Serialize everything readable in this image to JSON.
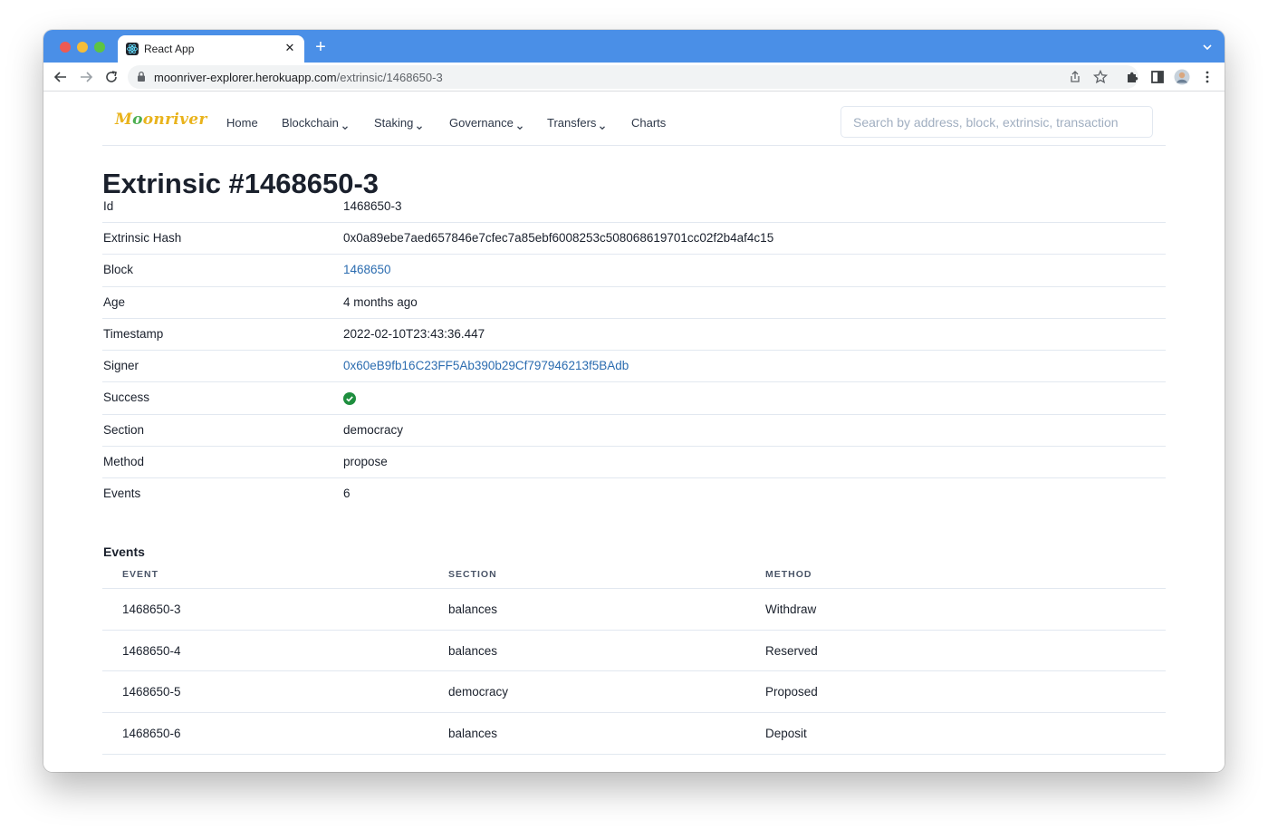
{
  "browser": {
    "tab_title": "React App",
    "url_host": "moonriver-explorer.herokuapp.com",
    "url_path": "/extrinsic/1468650-3"
  },
  "site": {
    "logo_text_1": "M",
    "logo_text_2": "o",
    "logo_text_3": "onriver",
    "nav": [
      {
        "label": "Home",
        "icon": "none"
      },
      {
        "label": "Blockchain",
        "icon": "chevron-down-icon"
      },
      {
        "label": "Staking",
        "icon": "chevron-down-icon"
      },
      {
        "label": "Governance",
        "icon": "chevron-down-icon"
      },
      {
        "label": "Transfers",
        "icon": "chevron-down-icon"
      },
      {
        "label": "Charts",
        "icon": "none"
      }
    ],
    "search_placeholder": "Search by address, block, extrinsic, transaction"
  },
  "page_title": "Extrinsic #1468650-3",
  "details": [
    {
      "key": "Id",
      "value": "1468650-3"
    },
    {
      "key": "Extrinsic Hash",
      "value": "0x0a89ebe7aed657846e7cfec7a85ebf6008253c508068619701cc02f2b4af4c15"
    },
    {
      "key": "Block",
      "value": "1468650"
    },
    {
      "key": "Age",
      "value": "4 months ago"
    },
    {
      "key": "Timestamp",
      "value": "2022-02-10T23:43:36.447"
    },
    {
      "key": "Signer",
      "value": "0x60eB9fb16C23FF5Ab390b29Cf797946213f5BAdb"
    },
    {
      "key": "Success",
      "value": "success-check-icon"
    },
    {
      "key": "Section",
      "value": "democracy"
    },
    {
      "key": "Method",
      "value": "propose"
    },
    {
      "key": "Events",
      "value": "6"
    }
  ],
  "events": {
    "heading": "Events",
    "columns": [
      "EVENT",
      "SECTION",
      "METHOD"
    ],
    "rows": [
      {
        "event": "1468650-3",
        "section": "balances",
        "method": "Withdraw"
      },
      {
        "event": "1468650-4",
        "section": "balances",
        "method": "Reserved"
      },
      {
        "event": "1468650-5",
        "section": "democracy",
        "method": "Proposed"
      },
      {
        "event": "1468650-6",
        "section": "balances",
        "method": "Deposit"
      }
    ]
  },
  "colors": {
    "chrome_blue": "#4a8fe7",
    "link": "#2b6cb0",
    "logo_gold": "#e9b31c",
    "success_green": "#1e8e3e"
  }
}
